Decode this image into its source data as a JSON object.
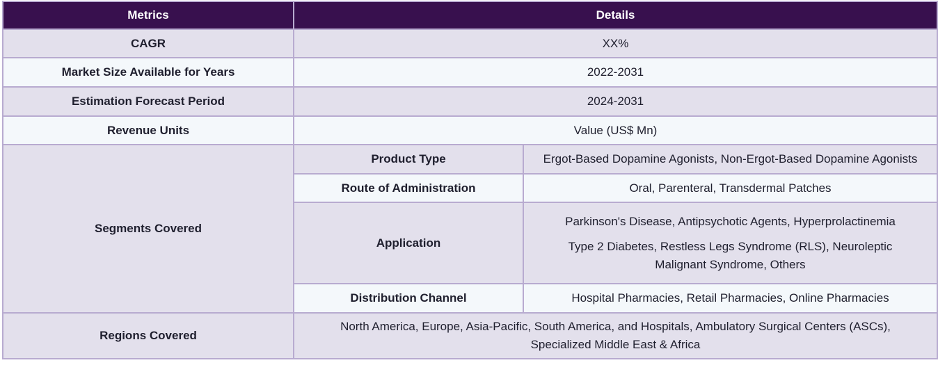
{
  "header": {
    "metrics": "Metrics",
    "details": "Details"
  },
  "rows": {
    "cagr": {
      "label": "CAGR",
      "value": "XX%"
    },
    "market_size": {
      "label": "Market Size Available for Years",
      "value": "2022-2031"
    },
    "forecast": {
      "label": "Estimation Forecast Period",
      "value": "2024-2031"
    },
    "revenue": {
      "label": "Revenue Units",
      "value": "Value (US$ Mn)"
    }
  },
  "segments": {
    "label": "Segments Covered",
    "product_type": {
      "label": "Product Type",
      "value": "Ergot-Based Dopamine Agonists, Non-Ergot-Based Dopamine Agonists"
    },
    "route": {
      "label": "Route of Administration",
      "value": "Oral, Parenteral, Transdermal Patches"
    },
    "application": {
      "label": "Application",
      "line1": "Parkinson's Disease, Antipsychotic Agents, Hyperprolactinemia",
      "line2": "Type 2 Diabetes, Restless Legs Syndrome (RLS), Neuroleptic Malignant Syndrome, Others"
    },
    "distribution": {
      "label": "Distribution Channel",
      "value": "Hospital Pharmacies, Retail Pharmacies, Online Pharmacies"
    }
  },
  "regions": {
    "label": "Regions Covered",
    "value": "North America, Europe, Asia-Pacific, South America, and Hospitals, Ambulatory Surgical Centers (ASCs), Specialized Middle East & Africa"
  }
}
